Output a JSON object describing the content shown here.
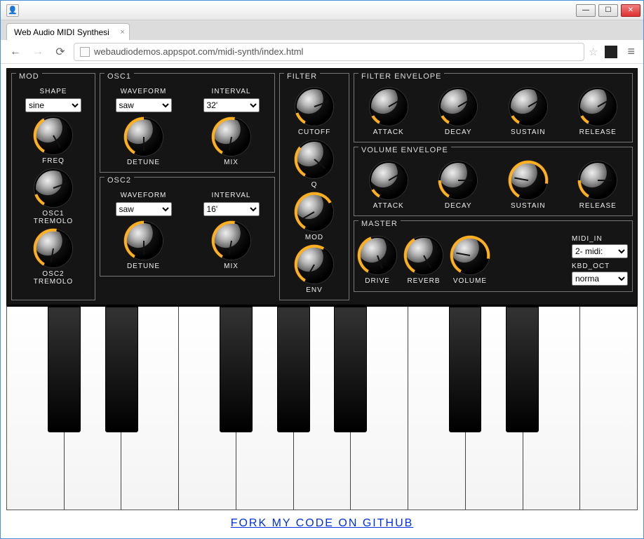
{
  "browser": {
    "tab_title": "Web Audio MIDI Synthesi",
    "url": "webaudiodemos.appspot.com/midi-synth/index.html"
  },
  "mod": {
    "title": "MOD",
    "shape_label": "Shape",
    "shape_value": "sine",
    "freq_label": "Freq",
    "osc1_trem_label": "OSC1\nTremolo",
    "osc2_trem_label": "OSC2\nTremolo"
  },
  "osc1": {
    "title": "OSC1",
    "waveform_label": "Waveform",
    "waveform_value": "saw",
    "interval_label": "Interval",
    "interval_value": "32'",
    "detune_label": "Detune",
    "mix_label": "Mix"
  },
  "osc2": {
    "title": "OSC2",
    "waveform_label": "Waveform",
    "waveform_value": "saw",
    "interval_label": "Interval",
    "interval_value": "16'",
    "detune_label": "Detune",
    "mix_label": "Mix"
  },
  "filter": {
    "title": "Filter",
    "cutoff_label": "Cutoff",
    "q_label": "Q",
    "mod_label": "Mod",
    "env_label": "Env"
  },
  "filter_env": {
    "title": "Filter Envelope",
    "attack_label": "Attack",
    "decay_label": "Decay",
    "sustain_label": "Sustain",
    "release_label": "Release"
  },
  "volume_env": {
    "title": "Volume Envelope",
    "attack_label": "Attack",
    "decay_label": "Decay",
    "sustain_label": "Sustain",
    "release_label": "Release"
  },
  "master": {
    "title": "Master",
    "drive_label": "Drive",
    "reverb_label": "Reverb",
    "volume_label": "Volume",
    "midi_in_label": "MIDI_IN",
    "midi_in_value": "2- MIDI:",
    "kbd_oct_label": "KBD_OCT",
    "kbd_oct_value": "norma"
  },
  "footer": {
    "github_link": "Fork my code on Github"
  },
  "knob_values": {
    "mod_freq": 120,
    "mod_osc1trem": 40,
    "mod_osc2trem": 160,
    "osc1_detune": 150,
    "osc1_mix": 160,
    "osc2_detune": 150,
    "osc2_mix": 160,
    "filter_cutoff": 40,
    "filter_q": 100,
    "filter_mod": 210,
    "filter_env": 180,
    "fenv_attack": 30,
    "fenv_decay": 30,
    "fenv_sustain": 30,
    "fenv_release": 30,
    "venv_attack": 30,
    "venv_decay": 60,
    "venv_sustain": 250,
    "venv_release": 60,
    "m_drive": 130,
    "m_reverb": 120,
    "m_volume": 250
  }
}
